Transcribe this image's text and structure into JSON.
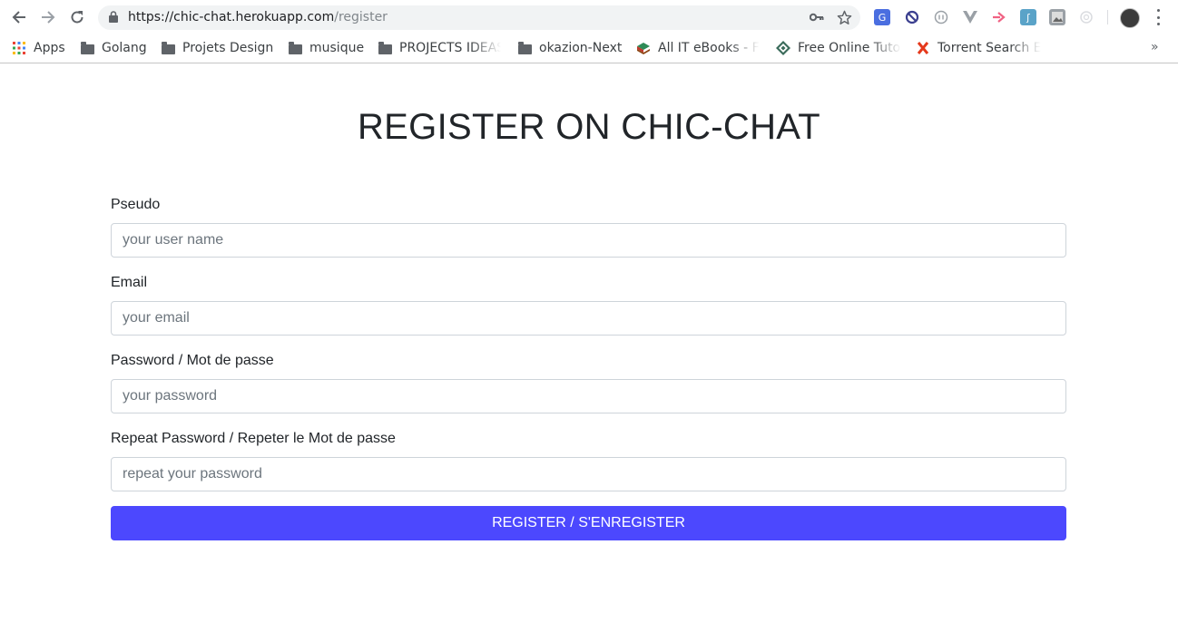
{
  "browser": {
    "url_host": "https://chic-chat.herokuapp.com",
    "url_path": "/register",
    "bookmarks": [
      {
        "label": "Apps",
        "icon": "apps-grid-icon"
      },
      {
        "label": "Golang",
        "icon": "folder-icon"
      },
      {
        "label": "Projets Design",
        "icon": "folder-icon"
      },
      {
        "label": "musique",
        "icon": "folder-icon"
      },
      {
        "label": "PROJECTS IDEAS",
        "icon": "folder-icon"
      },
      {
        "label": "okazion-Next",
        "icon": "folder-icon"
      },
      {
        "label": "All IT eBooks - Free",
        "icon": "book-icon"
      },
      {
        "label": "Free Online Tutorials",
        "icon": "diamond-icon"
      },
      {
        "label": "Torrent Search Engine",
        "icon": "x-logo-icon"
      }
    ]
  },
  "page": {
    "title": "REGISTER ON CHIC-CHAT",
    "fields": {
      "pseudo": {
        "label": "Pseudo",
        "placeholder": "your user name"
      },
      "email": {
        "label": "Email",
        "placeholder": "your email"
      },
      "password": {
        "label": "Password / Mot de passe",
        "placeholder": "your password"
      },
      "repeat_password": {
        "label": "Repeat Password / Repeter le Mot de passe",
        "placeholder": "repeat your password"
      }
    },
    "submit_label": "REGISTER / S'ENREGISTER"
  },
  "colors": {
    "button_bg": "#4c48fe",
    "text": "#212529",
    "input_border": "#ced4da"
  }
}
